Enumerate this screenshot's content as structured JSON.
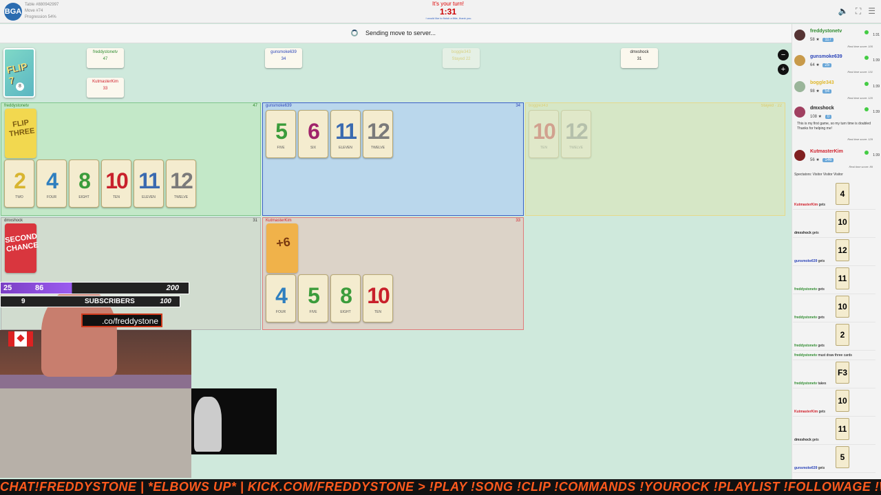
{
  "topbar": {
    "logo_text": "BGA",
    "table_line": "Table #880942997",
    "move_line": "Move #74",
    "progress_line": "Progression 54%",
    "turn_label": "It's your turn!",
    "timer": "1:31",
    "subtitle": "I would like to finish a little, thank you.",
    "icons": [
      "volume-icon",
      "fullscreen-icon",
      "menu-icon"
    ]
  },
  "status": {
    "text": "Sending move to server..."
  },
  "draw_pile": {
    "title": "FLIP 7",
    "count": "8"
  },
  "score_chips": [
    {
      "name": "freddystonetv",
      "score": "47",
      "color": "#2e8b2e"
    },
    {
      "name": "gunsmoke639",
      "score": "34",
      "color": "#2a43b8"
    },
    {
      "name": "boggle343",
      "score": "Stayed 22",
      "color": "#e0b82a"
    },
    {
      "name": "dmxshock",
      "score": "31",
      "color": "#222222"
    },
    {
      "name": "KutmasterKim",
      "score": "33",
      "color": "#d0202b"
    }
  ],
  "panels": [
    {
      "name": "freddystonetv",
      "score": "47",
      "color": "#2e8b2e",
      "special": "FLIP THREE",
      "cards": [
        {
          "v": "2",
          "w": "TWO",
          "c": "#d8b530"
        },
        {
          "v": "4",
          "w": "FOUR",
          "c": "#2f7fbf"
        },
        {
          "v": "8",
          "w": "EIGHT",
          "c": "#3b9c3b"
        },
        {
          "v": "10",
          "w": "TEN",
          "c": "#c8202b"
        },
        {
          "v": "11",
          "w": "ELEVEN",
          "c": "#3a6ab0"
        },
        {
          "v": "12",
          "w": "TWELVE",
          "c": "#7a7a7a"
        }
      ]
    },
    {
      "name": "gunsmoke639",
      "score": "34",
      "color": "#2a43b8",
      "cards": [
        {
          "v": "5",
          "w": "FIVE",
          "c": "#3b9c3b"
        },
        {
          "v": "6",
          "w": "SIX",
          "c": "#a0246b"
        },
        {
          "v": "11",
          "w": "ELEVEN",
          "c": "#3a6ab0"
        },
        {
          "v": "12",
          "w": "TWELVE",
          "c": "#7a7a7a"
        }
      ]
    },
    {
      "name": "boggle343",
      "score": "Stayed · 22",
      "color": "#e0b82a",
      "cards": [
        {
          "v": "10",
          "w": "TEN",
          "c": "#c8202b"
        },
        {
          "v": "12",
          "w": "TWELVE",
          "c": "#7a7a7a"
        }
      ]
    },
    {
      "name": "dmxshock",
      "score": "31",
      "color": "#333333",
      "special": "SECOND CHANCE"
    },
    {
      "name": "KutmasterKim",
      "score": "33",
      "color": "#d0202b",
      "special": "+6",
      "cards": [
        {
          "v": "4",
          "w": "FOUR",
          "c": "#2f7fbf"
        },
        {
          "v": "5",
          "w": "FIVE",
          "c": "#3b9c3b"
        },
        {
          "v": "8",
          "w": "EIGHT",
          "c": "#3b9c3b"
        },
        {
          "v": "10",
          "w": "TEN",
          "c": "#c8202b"
        }
      ]
    }
  ],
  "players": [
    {
      "name": "freddystonetv",
      "rating": "58",
      "badge": "117",
      "time": "1:31",
      "rts": "Real time score: 105",
      "color": "#2e8b2e",
      "avatar": "#553333"
    },
    {
      "name": "gunsmoke639",
      "rating": "64",
      "badge": "25",
      "time": "1:39",
      "rts": "Real time score: 131",
      "color": "#2a43b8",
      "avatar": "#c89a4a"
    },
    {
      "name": "boggle343",
      "rating": "98",
      "badge": "54",
      "time": "1:39",
      "rts": "Real time score: 120",
      "color": "#e0b82a",
      "avatar": "#9ab59a"
    },
    {
      "name": "dmxshock",
      "rating": "108",
      "badge": "0",
      "time": "1:39",
      "rts": "Real time score: 129",
      "color": "#222222",
      "avatar": "#a04060",
      "msg1": "This is my first game, so my turn time is doubled",
      "msg2": "Thanks for helping me!"
    },
    {
      "name": "KutmasterKim",
      "rating": "56",
      "badge": "146",
      "time": "1:39",
      "rts": "Real time score: 89",
      "color": "#d0202b",
      "avatar": "#802020"
    }
  ],
  "spectators": "Spectators:  Visitor  Visitor  Visitor",
  "log": [
    {
      "who": "KutmasterKim",
      "act": "gets",
      "card": "4",
      "color": "#d0202b"
    },
    {
      "who": "dmxshock",
      "act": "gets",
      "card": "10",
      "color": "#222222"
    },
    {
      "who": "gunsmoke639",
      "act": "gets",
      "card": "12",
      "color": "#2a43b8"
    },
    {
      "who": "freddystonetv",
      "act": "gets",
      "card": "11",
      "color": "#2e8b2e"
    },
    {
      "who": "freddystonetv",
      "act": "gets",
      "card": "10",
      "color": "#2e8b2e"
    },
    {
      "who": "freddystonetv",
      "act": "gets",
      "card": "2",
      "color": "#2e8b2e"
    },
    {
      "who": "freddystonetv",
      "act": "must draw three cards",
      "card": "",
      "color": "#2e8b2e"
    },
    {
      "who": "freddystonetv",
      "act": "takes",
      "card": "F3",
      "color": "#2e8b2e"
    },
    {
      "who": "KutmasterKim",
      "act": "gets",
      "card": "10",
      "color": "#d0202b"
    },
    {
      "who": "dmxshock",
      "act": "gets",
      "card": "11",
      "color": "#222222"
    },
    {
      "who": "gunsmoke639",
      "act": "gets",
      "card": "5",
      "color": "#2a43b8"
    }
  ],
  "overlay": {
    "goal1_left": "25",
    "goal1_mid": "86",
    "goal1_right": "200",
    "goal2_left": "9",
    "goal2_mid": "SUBSCRIBERS",
    "goal2_right": "100",
    "kick": ".co/freddystone",
    "ticker": "CHAT!FREDDYSTONE  |  *ELBOWS UP*  |  KICK.COM/FREDDYSTONE >   !PLAY !SONG !CLIP !COMMANDS  !YOUROCK !PLAYLIST !FOLLOWAGE !W"
  }
}
